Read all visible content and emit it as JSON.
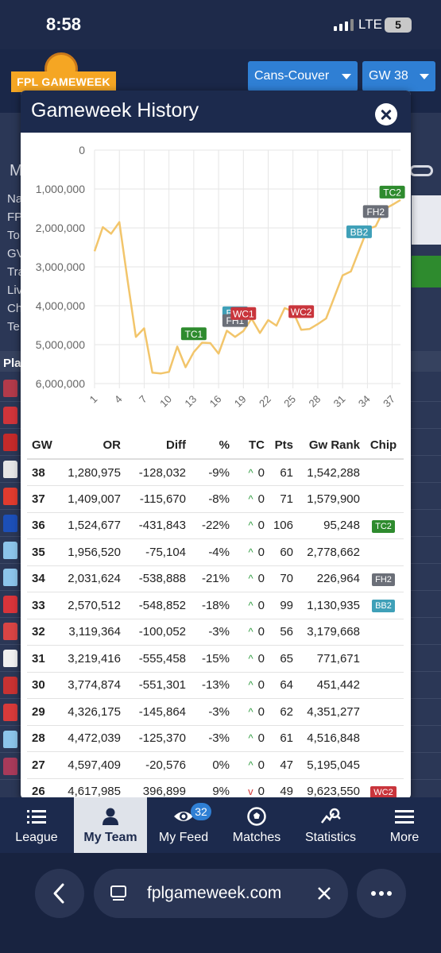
{
  "status_bar": {
    "time": "8:58",
    "network": "LTE",
    "battery": "5"
  },
  "app": {
    "logo_text": "FPL GAMEWEEK",
    "league_select": "Cans-Couver",
    "gw_select": "GW 38"
  },
  "background_labels": [
    "M",
    "Na",
    "FP",
    "To",
    "GV",
    "Tra",
    "Liv",
    "Ch",
    "Te",
    "Pla"
  ],
  "modal": {
    "title": "Gameweek History",
    "close_icon": "close-icon"
  },
  "chart_data": {
    "type": "line",
    "title": "",
    "xlabel": "",
    "ylabel": "",
    "y_reversed": true,
    "ylim": [
      0,
      6000000
    ],
    "y_ticks": [
      "0",
      "1,000,000",
      "2,000,000",
      "3,000,000",
      "4,000,000",
      "5,000,000",
      "6,000,000"
    ],
    "x_ticks": [
      "1",
      "4",
      "7",
      "10",
      "13",
      "16",
      "19",
      "22",
      "25",
      "28",
      "31",
      "34",
      "37"
    ],
    "series": [
      {
        "color": "#f2c56b",
        "x": [
          1,
          2,
          3,
          4,
          5,
          6,
          7,
          8,
          9,
          10,
          11,
          12,
          13,
          14,
          15,
          16,
          17,
          18,
          19,
          20,
          21,
          22,
          23,
          24,
          25,
          26,
          27,
          28,
          29,
          30,
          31,
          32,
          33,
          34,
          35,
          36,
          37,
          38
        ],
        "y": [
          2600000,
          1980000,
          2150000,
          1850000,
          3350000,
          4800000,
          4580000,
          5720000,
          5740000,
          5700000,
          5050000,
          5580000,
          5190000,
          4950000,
          4960000,
          5230000,
          4640000,
          4800000,
          4650000,
          4330000,
          4700000,
          4370000,
          4510000,
          4060000,
          4150000,
          4617985,
          4597409,
          4472039,
          4326175,
          3774874,
          3219416,
          3119364,
          2570512,
          2031624,
          1956520,
          1524677,
          1409007,
          1280975
        ]
      }
    ],
    "annotations": [
      {
        "label": "TC1",
        "x": 13,
        "y": 4720000,
        "color": "#2e8b2e"
      },
      {
        "label": "BB1",
        "x": 18,
        "y": 4180000,
        "color": "#3fa0b8"
      },
      {
        "label": "FH1",
        "x": 18,
        "y": 4380000,
        "color": "#6b6f78"
      },
      {
        "label": "WC1",
        "x": 19,
        "y": 4200000,
        "color": "#c9353c"
      },
      {
        "label": "WC2",
        "x": 26,
        "y": 4150000,
        "color": "#c9353c"
      },
      {
        "label": "BB2",
        "x": 33,
        "y": 2100000,
        "color": "#3fa0b8"
      },
      {
        "label": "FH2",
        "x": 35,
        "y": 1580000,
        "color": "#6b6f78"
      },
      {
        "label": "TC2",
        "x": 37,
        "y": 1080000,
        "color": "#2e8b2e"
      }
    ]
  },
  "table": {
    "headers": [
      "GW",
      "OR",
      "Diff",
      "%",
      "TC",
      "Pts",
      "Gw Rank",
      "Chip"
    ],
    "rows": [
      {
        "gw": "38",
        "or": "1,280,975",
        "diff": "-128,032",
        "pct": "-9%",
        "trend": "up",
        "tc": "0",
        "pts": "61",
        "rank": "1,542,288",
        "chip": "",
        "chip_color": ""
      },
      {
        "gw": "37",
        "or": "1,409,007",
        "diff": "-115,670",
        "pct": "-8%",
        "trend": "up",
        "tc": "0",
        "pts": "71",
        "rank": "1,579,900",
        "chip": "",
        "chip_color": ""
      },
      {
        "gw": "36",
        "or": "1,524,677",
        "diff": "-431,843",
        "pct": "-22%",
        "trend": "up",
        "tc": "0",
        "pts": "106",
        "rank": "95,248",
        "chip": "TC2",
        "chip_color": "#2e8b2e"
      },
      {
        "gw": "35",
        "or": "1,956,520",
        "diff": "-75,104",
        "pct": "-4%",
        "trend": "up",
        "tc": "0",
        "pts": "60",
        "rank": "2,778,662",
        "chip": "",
        "chip_color": ""
      },
      {
        "gw": "34",
        "or": "2,031,624",
        "diff": "-538,888",
        "pct": "-21%",
        "trend": "up",
        "tc": "0",
        "pts": "70",
        "rank": "226,964",
        "chip": "FH2",
        "chip_color": "#6b6f78"
      },
      {
        "gw": "33",
        "or": "2,570,512",
        "diff": "-548,852",
        "pct": "-18%",
        "trend": "up",
        "tc": "0",
        "pts": "99",
        "rank": "1,130,935",
        "chip": "BB2",
        "chip_color": "#3fa0b8"
      },
      {
        "gw": "32",
        "or": "3,119,364",
        "diff": "-100,052",
        "pct": "-3%",
        "trend": "up",
        "tc": "0",
        "pts": "56",
        "rank": "3,179,668",
        "chip": "",
        "chip_color": ""
      },
      {
        "gw": "31",
        "or": "3,219,416",
        "diff": "-555,458",
        "pct": "-15%",
        "trend": "up",
        "tc": "0",
        "pts": "65",
        "rank": "771,671",
        "chip": "",
        "chip_color": ""
      },
      {
        "gw": "30",
        "or": "3,774,874",
        "diff": "-551,301",
        "pct": "-13%",
        "trend": "up",
        "tc": "0",
        "pts": "64",
        "rank": "451,442",
        "chip": "",
        "chip_color": ""
      },
      {
        "gw": "29",
        "or": "4,326,175",
        "diff": "-145,864",
        "pct": "-3%",
        "trend": "up",
        "tc": "0",
        "pts": "62",
        "rank": "4,351,277",
        "chip": "",
        "chip_color": ""
      },
      {
        "gw": "28",
        "or": "4,472,039",
        "diff": "-125,370",
        "pct": "-3%",
        "trend": "up",
        "tc": "0",
        "pts": "61",
        "rank": "4,516,848",
        "chip": "",
        "chip_color": ""
      },
      {
        "gw": "27",
        "or": "4,597,409",
        "diff": "-20,576",
        "pct": "0%",
        "trend": "up",
        "tc": "0",
        "pts": "47",
        "rank": "5,195,045",
        "chip": "",
        "chip_color": ""
      },
      {
        "gw": "26",
        "or": "4,617,985",
        "diff": "396,899",
        "pct": "9%",
        "trend": "down",
        "tc": "0",
        "pts": "49",
        "rank": "9,623,550",
        "chip": "WC2",
        "chip_color": "#c9353c"
      }
    ]
  },
  "bottom_nav": [
    {
      "label": "League",
      "icon": "list-icon",
      "active": false
    },
    {
      "label": "My Team",
      "icon": "person-icon",
      "active": true
    },
    {
      "label": "My Feed",
      "icon": "eye-icon",
      "active": false,
      "badge": "32"
    },
    {
      "label": "Matches",
      "icon": "soccer-ball-icon",
      "active": false
    },
    {
      "label": "Statistics",
      "icon": "chart-search-icon",
      "active": false
    },
    {
      "label": "More",
      "icon": "menu-icon",
      "active": false
    }
  ],
  "browser": {
    "url": "fplgameweek.com"
  }
}
